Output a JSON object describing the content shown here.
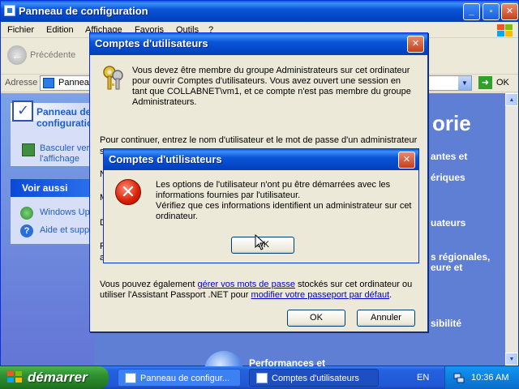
{
  "main_window": {
    "title": "Panneau de configuration",
    "menu": [
      "Fichier",
      "Edition",
      "Affichage",
      "Favoris",
      "Outils",
      "?"
    ],
    "back_label": "Précédente",
    "address_label": "Adresse",
    "address_value": "Panneau de configuration",
    "go_label": "OK"
  },
  "task_pane": {
    "panel_title": "Panneau de configuration",
    "switch_view": "Basculer vers l'affichage classique",
    "see_also_title": "Voir aussi",
    "links": [
      "Windows Update",
      "Aide et support"
    ]
  },
  "main_area": {
    "heading_fragment": "orie",
    "category_fragments": [
      "antes et",
      "ériques",
      "uateurs",
      "s régionales,",
      "eure et",
      "sibilité",
      "Performances et"
    ]
  },
  "back_dialog": {
    "title": "Comptes d'utilisateurs",
    "message1": "Vous devez être membre du groupe Administrateurs sur cet ordinateur pour ouvrir Comptes d'utilisateurs. Vous avez ouvert une session en tant que COLLABNET\\vm1, et ce compte n'est pas membre du groupe Administrateurs.",
    "message2": "Pour continuer, entrez le nom d'utilisateur et le mot de passe d'un administrateur",
    "message2b": "s",
    "partial_labels": [
      "N",
      "M",
      "D",
      "P",
      "a"
    ],
    "passport_pre": "Vous pouvez également ",
    "passport_link1": "gérer vos mots de passe",
    "passport_mid": " stockés sur cet ordinateur ou utiliser l'Assistant Passport .NET pour ",
    "passport_link2": "modifier votre passeport par défaut",
    "passport_post": ".",
    "ok_label": "OK",
    "cancel_label": "Annuler"
  },
  "error_dialog": {
    "title": "Comptes d'utilisateurs",
    "message1": "Les options de l'utilisateur n'ont pu être démarrées avec les informations fournies par l'utilisateur.",
    "message2": "Vérifiez que ces informations identifient un administrateur sur cet ordinateur.",
    "ok_label": "OK"
  },
  "taskbar": {
    "start_label": "démarrer",
    "items": [
      "Panneau de configur...",
      "Comptes d'utilisateurs"
    ],
    "language": "EN",
    "clock": "10:36 AM"
  },
  "icons": {
    "error": "error-x-icon",
    "keys": "keys-icon",
    "control_panel": "control-panel-icon",
    "windows_update": "windows-update-icon",
    "help": "help-icon"
  },
  "colors": {
    "title_bar": "#0a55d8",
    "close_button": "#c3401c",
    "dialog_bg": "#ece9d8",
    "start_button": "#2f8f2f",
    "link": "#0000cc"
  }
}
